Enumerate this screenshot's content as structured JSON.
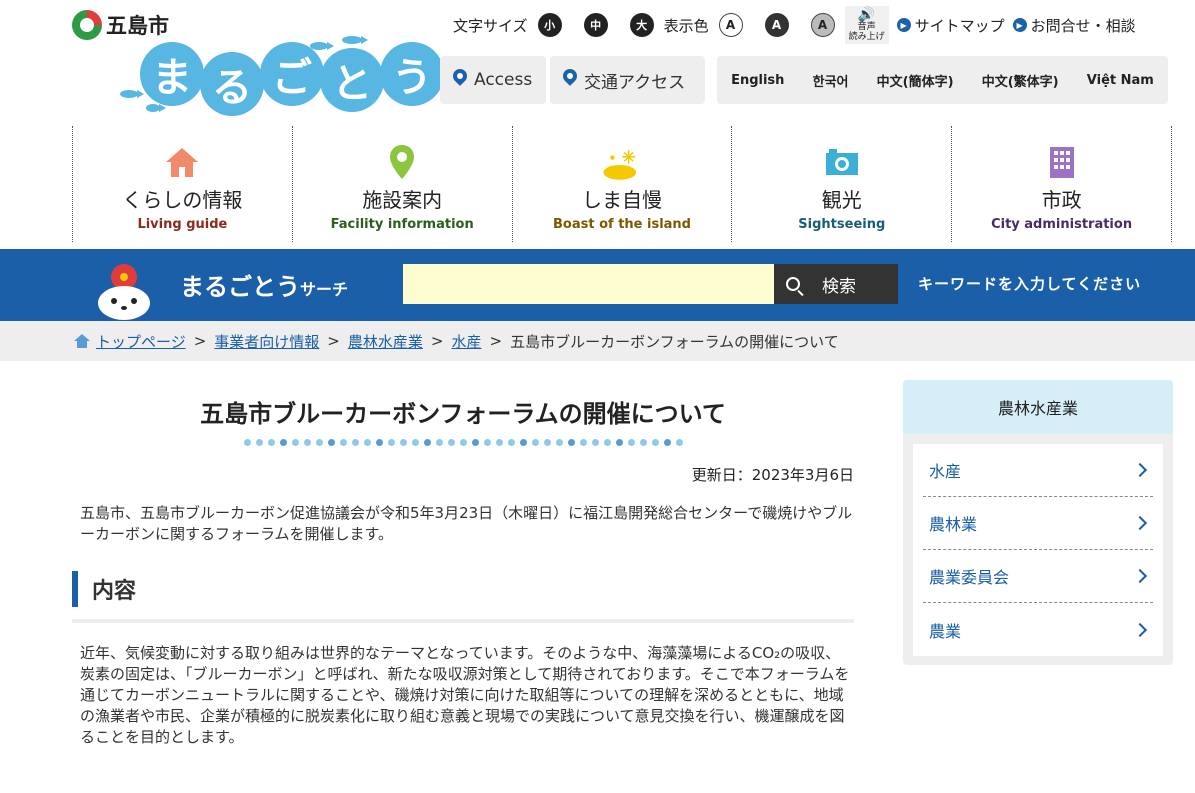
{
  "header": {
    "city_name": "五島市",
    "logo_chars": [
      "ま",
      "る",
      "ご",
      "と",
      "う"
    ],
    "font_size_label": "文字サイズ",
    "font_sizes": [
      "小",
      "中",
      "大"
    ],
    "color_label": "表示色",
    "color_options": [
      "A",
      "A",
      "A"
    ],
    "voice_label_1": "音声",
    "voice_label_2": "読み上げ",
    "sitemap": "サイトマップ",
    "contact": "お問合せ・相談",
    "access_en": "Access",
    "access_jp": "交通アクセス",
    "languages": [
      "English",
      "한국어",
      "中文(簡体字)",
      "中文(繁体字)",
      "Việt Nam"
    ]
  },
  "gnav": [
    {
      "jp": "くらしの情報",
      "en": "Living guide",
      "color": "#8b2a1e"
    },
    {
      "jp": "施設案内",
      "en": "Facility information",
      "color": "#2a5e1e"
    },
    {
      "jp": "しま自慢",
      "en": "Boast of the island",
      "color": "#7a5a00"
    },
    {
      "jp": "観光",
      "en": "Sightseeing",
      "color": "#1a5c7a"
    },
    {
      "jp": "市政",
      "en": "City administration",
      "color": "#4a2a6a"
    }
  ],
  "search": {
    "title": "まるごとう",
    "title_small": "サーチ",
    "placeholder": "",
    "button": "検索",
    "hint": "キーワードを入力してください"
  },
  "breadcrumb": {
    "items": [
      "トップページ",
      "事業者向け情報",
      "農林水産業",
      "水産"
    ],
    "current": "五島市ブルーカーボンフォーラムの開催について"
  },
  "main": {
    "title": "五島市ブルーカーボンフォーラムの開催について",
    "updated": "更新日：2023年3月6日",
    "lead": "五島市、五島市ブルーカーボン促進協議会が令和5年3月23日（木曜日）に福江島開発総合センターで磯焼けやブルーカーボンに関するフォーラムを開催します。",
    "section_heading": "内容",
    "body": "近年、気候変動に対する取り組みは世界的なテーマとなっています。そのような中、海藻藻場によるCO₂の吸収、炭素の固定は、「ブルーカーボン」と呼ばれ、新たな吸収源対策として期待されております。そこで本フォーラムを通じてカーボンニュートラルに関することや、磯焼け対策に向けた取組等についての理解を深めるとともに、地域の漁業者や市民、企業が積極的に脱炭素化に取り組む意義と現場での実践について意見交換を行い、機運醸成を図ることを目的とします。"
  },
  "sidebar": {
    "heading": "農林水産業",
    "items": [
      "水産",
      "農林業",
      "農業委員会",
      "農業"
    ]
  }
}
